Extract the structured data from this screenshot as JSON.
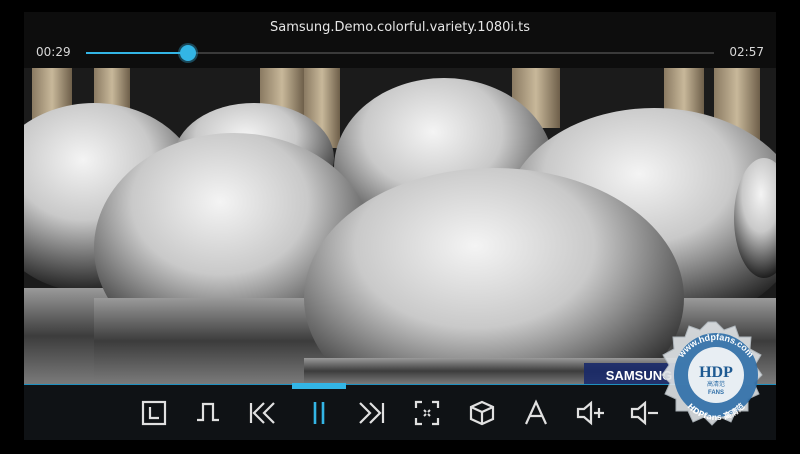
{
  "player": {
    "title": "Samsung.Demo.colorful.variety.1080i.ts",
    "elapsed": "00:29",
    "duration": "02:57",
    "progress": 0.163,
    "accent_color": "#33b5e5"
  },
  "video": {
    "caption": "SAMSUNG"
  },
  "controls": [
    {
      "name": "history",
      "icon": "clock-square-icon"
    },
    {
      "name": "playlist",
      "icon": "list-bracket-icon"
    },
    {
      "name": "previous",
      "icon": "skip-previous-icon"
    },
    {
      "name": "pause",
      "icon": "pause-icon"
    },
    {
      "name": "next",
      "icon": "skip-next-icon"
    },
    {
      "name": "fullscreen",
      "icon": "fullscreen-icon"
    },
    {
      "name": "3d",
      "icon": "cube-icon"
    },
    {
      "name": "subtitles",
      "icon": "text-a-icon"
    },
    {
      "name": "volume-up",
      "icon": "volume-plus-icon"
    },
    {
      "name": "volume-down",
      "icon": "volume-minus-icon"
    }
  ],
  "watermark": {
    "url": "www.hdpfans.com",
    "logo": "HDP",
    "sub": "FANS",
    "bottom": "HDPfans 高清范",
    "cn": "高清范"
  }
}
